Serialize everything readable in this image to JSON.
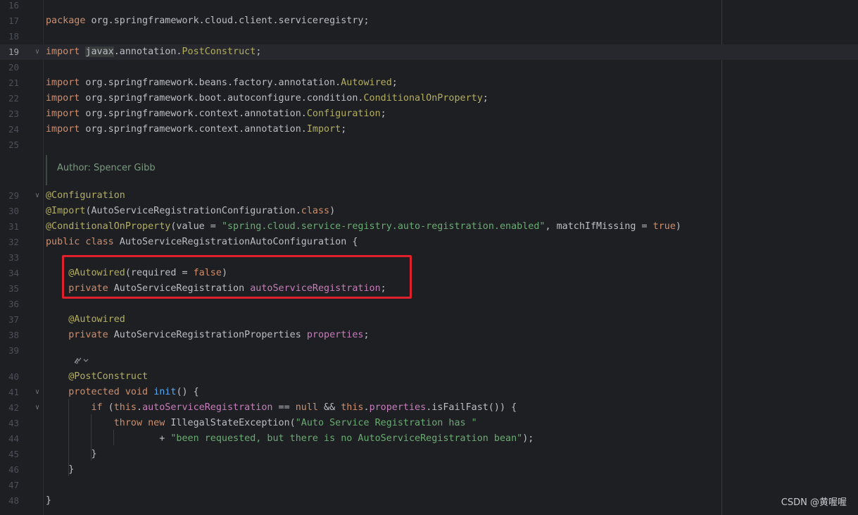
{
  "editor": {
    "lines": [
      {
        "n": "16",
        "segs": []
      },
      {
        "n": "17",
        "segs": [
          {
            "t": "package",
            "c": "kw"
          },
          {
            "t": " org.springframework.cloud.client.serviceregistry;",
            "c": ""
          }
        ]
      },
      {
        "n": "18",
        "segs": []
      },
      {
        "n": "19",
        "current": true,
        "fold": true,
        "segs": [
          {
            "t": "import",
            "c": "kw"
          },
          {
            "t": " ",
            "c": ""
          },
          {
            "t": "javax",
            "c": "hl-javax"
          },
          {
            "t": ".annotation.",
            "c": ""
          },
          {
            "t": "PostConstruct",
            "c": "ann"
          },
          {
            "t": ";",
            "c": ""
          }
        ]
      },
      {
        "n": "20",
        "segs": []
      },
      {
        "n": "21",
        "segs": [
          {
            "t": "import",
            "c": "kw"
          },
          {
            "t": " org.springframework.beans.factory.annotation.",
            "c": ""
          },
          {
            "t": "Autowired",
            "c": "ann"
          },
          {
            "t": ";",
            "c": ""
          }
        ]
      },
      {
        "n": "22",
        "segs": [
          {
            "t": "import",
            "c": "kw"
          },
          {
            "t": " org.springframework.boot.autoconfigure.condition.",
            "c": ""
          },
          {
            "t": "ConditionalOnProperty",
            "c": "ann"
          },
          {
            "t": ";",
            "c": ""
          }
        ]
      },
      {
        "n": "23",
        "segs": [
          {
            "t": "import",
            "c": "kw"
          },
          {
            "t": " org.springframework.context.annotation.",
            "c": ""
          },
          {
            "t": "Configuration",
            "c": "ann"
          },
          {
            "t": ";",
            "c": ""
          }
        ]
      },
      {
        "n": "24",
        "segs": [
          {
            "t": "import",
            "c": "kw"
          },
          {
            "t": " org.springframework.context.annotation.",
            "c": ""
          },
          {
            "t": "Import",
            "c": "ann"
          },
          {
            "t": ";",
            "c": ""
          }
        ]
      },
      {
        "n": "25",
        "segs": []
      },
      {
        "n": "29",
        "fold": true,
        "segs": [
          {
            "t": "@Configuration",
            "c": "ann"
          }
        ]
      },
      {
        "n": "30",
        "segs": [
          {
            "t": "@Import",
            "c": "ann"
          },
          {
            "t": "(AutoServiceRegistrationConfiguration.",
            "c": ""
          },
          {
            "t": "class",
            "c": "kw"
          },
          {
            "t": ")",
            "c": ""
          }
        ]
      },
      {
        "n": "31",
        "segs": [
          {
            "t": "@ConditionalOnProperty",
            "c": "ann"
          },
          {
            "t": "(value = ",
            "c": ""
          },
          {
            "t": "\"spring.cloud.service-registry.auto-registration.enabled\"",
            "c": "str"
          },
          {
            "t": ", matchIfMissing = ",
            "c": ""
          },
          {
            "t": "true",
            "c": "kw"
          },
          {
            "t": ")",
            "c": ""
          }
        ]
      },
      {
        "n": "32",
        "segs": [
          {
            "t": "public class",
            "c": "kw"
          },
          {
            "t": " AutoServiceRegistrationAutoConfiguration {",
            "c": ""
          }
        ]
      },
      {
        "n": "33",
        "segs": []
      },
      {
        "n": "34",
        "segs": [
          {
            "t": "    ",
            "c": ""
          },
          {
            "t": "@Autowired",
            "c": "ann"
          },
          {
            "t": "(required = ",
            "c": ""
          },
          {
            "t": "false",
            "c": "kw"
          },
          {
            "t": ")",
            "c": ""
          }
        ]
      },
      {
        "n": "35",
        "segs": [
          {
            "t": "    ",
            "c": ""
          },
          {
            "t": "private",
            "c": "kw"
          },
          {
            "t": " AutoServiceRegistration ",
            "c": ""
          },
          {
            "t": "autoServiceRegistration",
            "c": "fld"
          },
          {
            "t": ";",
            "c": ""
          }
        ]
      },
      {
        "n": "36",
        "segs": []
      },
      {
        "n": "37",
        "segs": [
          {
            "t": "    ",
            "c": ""
          },
          {
            "t": "@Autowired",
            "c": "ann"
          }
        ]
      },
      {
        "n": "38",
        "segs": [
          {
            "t": "    ",
            "c": ""
          },
          {
            "t": "private",
            "c": "kw"
          },
          {
            "t": " AutoServiceRegistrationProperties ",
            "c": ""
          },
          {
            "t": "properties",
            "c": "fld"
          },
          {
            "t": ";",
            "c": ""
          }
        ]
      },
      {
        "n": "39",
        "segs": []
      },
      {
        "n": "40",
        "segs": [
          {
            "t": "    ",
            "c": ""
          },
          {
            "t": "@PostConstruct",
            "c": "ann"
          }
        ]
      },
      {
        "n": "41",
        "fold": true,
        "segs": [
          {
            "t": "    ",
            "c": ""
          },
          {
            "t": "protected void",
            "c": "kw"
          },
          {
            "t": " ",
            "c": ""
          },
          {
            "t": "init",
            "c": "fn"
          },
          {
            "t": "() {",
            "c": ""
          }
        ]
      },
      {
        "n": "42",
        "fold": true,
        "segs": [
          {
            "t": "        ",
            "c": ""
          },
          {
            "t": "if",
            "c": "kw"
          },
          {
            "t": " (",
            "c": ""
          },
          {
            "t": "this",
            "c": "kw"
          },
          {
            "t": ".",
            "c": ""
          },
          {
            "t": "autoServiceRegistration",
            "c": "fld"
          },
          {
            "t": " == ",
            "c": ""
          },
          {
            "t": "null",
            "c": "kw"
          },
          {
            "t": " && ",
            "c": ""
          },
          {
            "t": "this",
            "c": "kw"
          },
          {
            "t": ".",
            "c": ""
          },
          {
            "t": "properties",
            "c": "fld"
          },
          {
            "t": ".isFailFast()) {",
            "c": ""
          }
        ]
      },
      {
        "n": "43",
        "segs": [
          {
            "t": "            ",
            "c": ""
          },
          {
            "t": "throw new",
            "c": "kw"
          },
          {
            "t": " IllegalStateException(",
            "c": ""
          },
          {
            "t": "\"Auto Service Registration has \"",
            "c": "str"
          }
        ]
      },
      {
        "n": "44",
        "segs": [
          {
            "t": "                    + ",
            "c": ""
          },
          {
            "t": "\"been requested, but there is no AutoServiceRegistration bean\"",
            "c": "str"
          },
          {
            "t": ");",
            "c": ""
          }
        ]
      },
      {
        "n": "45",
        "segs": [
          {
            "t": "        }",
            "c": ""
          }
        ]
      },
      {
        "n": "46",
        "segs": [
          {
            "t": "    }",
            "c": ""
          }
        ]
      },
      {
        "n": "47",
        "segs": []
      },
      {
        "n": "48",
        "segs": [
          {
            "t": "}",
            "c": ""
          }
        ]
      }
    ],
    "doc_comment": "Author: Spencer Gibb",
    "inlay_hint_icon": "ai-assist-icon",
    "highlight_color": "#e0202a"
  },
  "watermark": "CSDN @黄喔喔"
}
